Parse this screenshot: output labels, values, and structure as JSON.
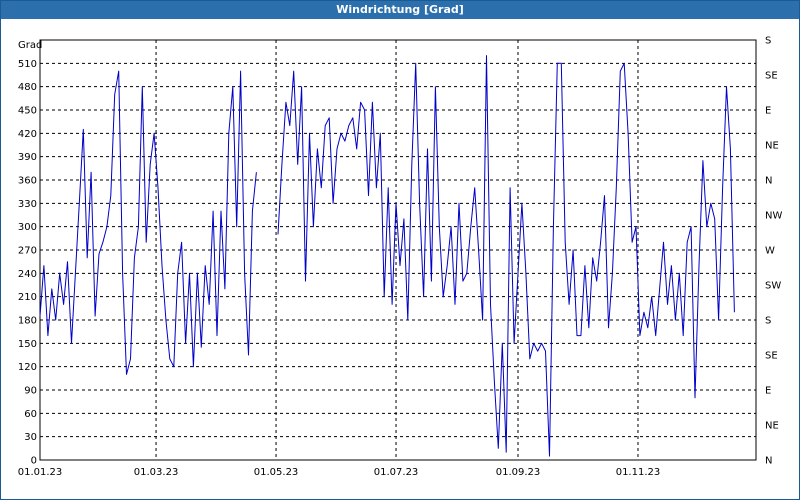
{
  "window": {
    "title": "Windrichtung [Grad]"
  },
  "colors": {
    "titlebar": "#2c6fad",
    "line": "#0000c8",
    "grid": "#000000"
  },
  "chart_data": {
    "type": "line",
    "title": "Windrichtung [Grad]",
    "ylabel": "Grad",
    "ylim": [
      0,
      540
    ],
    "xlim": [
      "2023-01-01",
      "2023-12-31"
    ],
    "grid": true,
    "y_ticks": [
      0,
      30,
      60,
      90,
      120,
      150,
      180,
      210,
      240,
      270,
      300,
      330,
      360,
      390,
      420,
      450,
      480,
      510
    ],
    "y_tick_labels": [
      "0",
      "30",
      "60",
      "90",
      "120",
      "150",
      "180",
      "210",
      "240",
      "270",
      "300",
      "330",
      "360",
      "390",
      "420",
      "450",
      "480",
      "510"
    ],
    "x_ticks": [
      "2023-01-01",
      "2023-03-01",
      "2023-05-01",
      "2023-07-01",
      "2023-09-01",
      "2023-11-01"
    ],
    "x_tick_labels": [
      "01.01.23",
      "01.03.23",
      "01.05.23",
      "01.07.23",
      "01.09.23",
      "01.11.23"
    ],
    "right_axis_labels": [
      "N",
      "NE",
      "E",
      "SE",
      "S",
      "SW",
      "W",
      "NW",
      "N",
      "NE",
      "E",
      "SE",
      "S"
    ],
    "series": [
      {
        "values": [
          [
            "2023-01-01",
            185
          ],
          [
            "2023-01-03",
            250
          ],
          [
            "2023-01-05",
            160
          ],
          [
            "2023-01-07",
            220
          ],
          [
            "2023-01-09",
            180
          ],
          [
            "2023-01-11",
            240
          ],
          [
            "2023-01-13",
            200
          ],
          [
            "2023-01-15",
            255
          ],
          [
            "2023-01-17",
            150
          ],
          [
            "2023-01-19",
            240
          ],
          [
            "2023-01-21",
            330
          ],
          [
            "2023-01-23",
            425
          ],
          [
            "2023-01-25",
            260
          ],
          [
            "2023-01-27",
            370
          ],
          [
            "2023-01-29",
            185
          ],
          [
            "2023-01-31",
            265
          ],
          [
            "2023-02-02",
            280
          ],
          [
            "2023-02-04",
            300
          ],
          [
            "2023-02-06",
            340
          ],
          [
            "2023-02-08",
            470
          ],
          [
            "2023-02-10",
            500
          ],
          [
            "2023-02-12",
            240
          ],
          [
            "2023-02-14",
            110
          ],
          [
            "2023-02-16",
            130
          ],
          [
            "2023-02-18",
            260
          ],
          [
            "2023-02-20",
            300
          ],
          [
            "2023-02-22",
            480
          ],
          [
            "2023-02-24",
            280
          ],
          [
            "2023-02-26",
            380
          ],
          [
            "2023-02-28",
            420
          ],
          [
            "2023-03-02",
            350
          ],
          [
            "2023-03-04",
            250
          ],
          [
            "2023-03-06",
            180
          ],
          [
            "2023-03-08",
            130
          ],
          [
            "2023-03-10",
            120
          ],
          [
            "2023-03-12",
            240
          ],
          [
            "2023-03-14",
            280
          ],
          [
            "2023-03-16",
            150
          ],
          [
            "2023-03-18",
            240
          ],
          [
            "2023-03-20",
            120
          ],
          [
            "2023-03-22",
            240
          ],
          [
            "2023-03-24",
            145
          ],
          [
            "2023-03-26",
            250
          ],
          [
            "2023-03-28",
            200
          ],
          [
            "2023-03-30",
            320
          ],
          [
            "2023-04-01",
            160
          ],
          [
            "2023-04-03",
            320
          ],
          [
            "2023-04-05",
            220
          ],
          [
            "2023-04-07",
            420
          ],
          [
            "2023-04-09",
            480
          ],
          [
            "2023-04-11",
            300
          ],
          [
            "2023-04-13",
            500
          ],
          [
            "2023-04-15",
            240
          ],
          [
            "2023-04-17",
            135
          ],
          [
            "2023-04-19",
            320
          ],
          [
            "2023-04-21",
            370
          ],
          null,
          [
            "2023-05-02",
            290
          ],
          [
            "2023-05-04",
            380
          ],
          [
            "2023-05-06",
            460
          ],
          [
            "2023-05-08",
            430
          ],
          [
            "2023-05-10",
            500
          ],
          [
            "2023-05-12",
            380
          ],
          [
            "2023-05-14",
            480
          ],
          [
            "2023-05-16",
            230
          ],
          [
            "2023-05-18",
            420
          ],
          [
            "2023-05-20",
            300
          ],
          [
            "2023-05-22",
            400
          ],
          [
            "2023-05-24",
            350
          ],
          [
            "2023-05-26",
            430
          ],
          [
            "2023-05-28",
            440
          ],
          [
            "2023-05-30",
            330
          ],
          [
            "2023-06-01",
            400
          ],
          [
            "2023-06-03",
            420
          ],
          [
            "2023-06-05",
            410
          ],
          [
            "2023-06-07",
            430
          ],
          [
            "2023-06-09",
            440
          ],
          [
            "2023-06-11",
            400
          ],
          [
            "2023-06-13",
            460
          ],
          [
            "2023-06-15",
            450
          ],
          [
            "2023-06-17",
            340
          ],
          [
            "2023-06-19",
            460
          ],
          [
            "2023-06-21",
            350
          ],
          [
            "2023-06-23",
            420
          ],
          [
            "2023-06-25",
            210
          ],
          [
            "2023-06-27",
            350
          ],
          [
            "2023-06-29",
            200
          ],
          [
            "2023-07-01",
            330
          ],
          [
            "2023-07-03",
            250
          ],
          [
            "2023-07-05",
            310
          ],
          [
            "2023-07-07",
            180
          ],
          [
            "2023-07-09",
            380
          ],
          [
            "2023-07-11",
            510
          ],
          [
            "2023-07-13",
            330
          ],
          [
            "2023-07-15",
            210
          ],
          [
            "2023-07-17",
            400
          ],
          [
            "2023-07-19",
            230
          ],
          [
            "2023-07-21",
            480
          ],
          [
            "2023-07-23",
            300
          ],
          [
            "2023-07-25",
            210
          ],
          [
            "2023-07-27",
            250
          ],
          [
            "2023-07-29",
            300
          ],
          [
            "2023-07-31",
            200
          ],
          [
            "2023-08-02",
            330
          ],
          [
            "2023-08-04",
            230
          ],
          [
            "2023-08-06",
            240
          ],
          [
            "2023-08-08",
            300
          ],
          [
            "2023-08-10",
            350
          ],
          [
            "2023-08-12",
            270
          ],
          [
            "2023-08-14",
            180
          ],
          [
            "2023-08-16",
            520
          ],
          [
            "2023-08-18",
            200
          ],
          [
            "2023-08-20",
            100
          ],
          [
            "2023-08-22",
            15
          ],
          [
            "2023-08-24",
            150
          ],
          [
            "2023-08-26",
            10
          ],
          [
            "2023-08-28",
            350
          ],
          [
            "2023-08-30",
            150
          ],
          [
            "2023-09-01",
            240
          ],
          [
            "2023-09-03",
            330
          ],
          [
            "2023-09-05",
            240
          ],
          [
            "2023-09-07",
            130
          ],
          [
            "2023-09-09",
            150
          ],
          [
            "2023-09-11",
            140
          ],
          [
            "2023-09-13",
            150
          ],
          [
            "2023-09-15",
            140
          ],
          [
            "2023-09-17",
            5
          ],
          [
            "2023-09-19",
            300
          ],
          [
            "2023-09-21",
            510
          ],
          [
            "2023-09-23",
            510
          ],
          [
            "2023-09-25",
            280
          ],
          [
            "2023-09-27",
            200
          ],
          [
            "2023-09-29",
            270
          ],
          [
            "2023-10-01",
            160
          ],
          [
            "2023-10-03",
            160
          ],
          [
            "2023-10-05",
            250
          ],
          [
            "2023-10-07",
            170
          ],
          [
            "2023-10-09",
            260
          ],
          [
            "2023-10-11",
            230
          ],
          [
            "2023-10-13",
            280
          ],
          [
            "2023-10-15",
            340
          ],
          [
            "2023-10-17",
            170
          ],
          [
            "2023-10-19",
            240
          ],
          [
            "2023-10-21",
            350
          ],
          [
            "2023-10-23",
            500
          ],
          [
            "2023-10-25",
            510
          ],
          [
            "2023-10-27",
            420
          ],
          [
            "2023-10-29",
            280
          ],
          [
            "2023-10-31",
            300
          ],
          [
            "2023-11-02",
            160
          ],
          [
            "2023-11-04",
            190
          ],
          [
            "2023-11-06",
            170
          ],
          [
            "2023-11-08",
            210
          ],
          [
            "2023-11-10",
            160
          ],
          [
            "2023-11-12",
            220
          ],
          [
            "2023-11-14",
            280
          ],
          [
            "2023-11-16",
            200
          ],
          [
            "2023-11-18",
            250
          ],
          [
            "2023-11-20",
            180
          ],
          [
            "2023-11-22",
            240
          ],
          [
            "2023-11-24",
            160
          ],
          [
            "2023-11-26",
            280
          ],
          [
            "2023-11-28",
            300
          ],
          [
            "2023-11-30",
            80
          ],
          [
            "2023-12-02",
            250
          ],
          [
            "2023-12-04",
            385
          ],
          [
            "2023-12-06",
            300
          ],
          [
            "2023-12-08",
            330
          ],
          [
            "2023-12-10",
            310
          ],
          [
            "2023-12-12",
            180
          ],
          [
            "2023-12-14",
            350
          ],
          [
            "2023-12-16",
            480
          ],
          [
            "2023-12-18",
            400
          ],
          [
            "2023-12-20",
            190
          ]
        ]
      }
    ]
  }
}
